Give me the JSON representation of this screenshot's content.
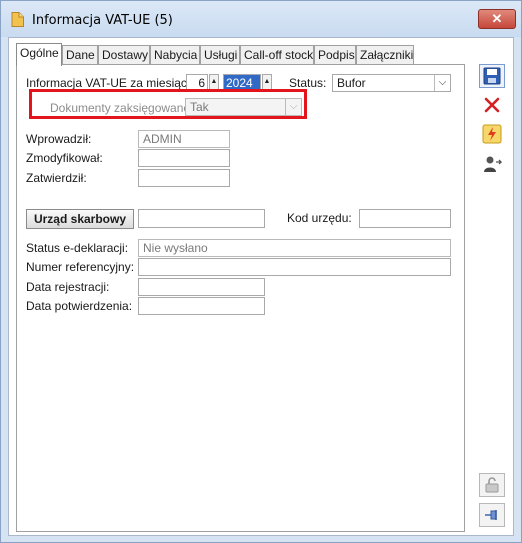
{
  "window": {
    "title": "Informacja VAT-UE (5)",
    "close_label": "✕"
  },
  "tabs": [
    {
      "label": "Ogólne",
      "active": true
    },
    {
      "label": "Dane"
    },
    {
      "label": "Dostawy"
    },
    {
      "label": "Nabycia"
    },
    {
      "label": "Usługi"
    },
    {
      "label": "Call-off stock"
    },
    {
      "label": "Podpis"
    },
    {
      "label": "Załączniki"
    }
  ],
  "form": {
    "period_label": "Informacja VAT-UE za miesiąc:",
    "month_value": "6",
    "year_value": "2024",
    "status_label": "Status:",
    "status_value": "Bufor",
    "posted_docs_label": "Dokumenty zaksięgowane:",
    "posted_docs_value": "Tak",
    "entered_by_label": "Wprowadził:",
    "entered_by_value": "ADMIN",
    "modified_by_label": "Zmodyfikował:",
    "modified_by_value": "",
    "approved_by_label": "Zatwierdził:",
    "approved_by_value": "",
    "tax_office_button": "Urząd skarbowy",
    "tax_office_value": "",
    "office_code_label": "Kod urzędu:",
    "office_code_value": "",
    "edecl_status_label": "Status e-deklaracji:",
    "edecl_status_value": "Nie wysłano",
    "ref_number_label": "Numer referencyjny:",
    "ref_number_value": "",
    "reg_date_label": "Data rejestracji:",
    "reg_date_value": "",
    "confirm_date_label": "Data potwierdzenia:",
    "confirm_date_value": ""
  },
  "toolbar": {
    "save_icon": "save-icon",
    "delete_icon": "delete-icon",
    "lightning_icon": "lightning-icon",
    "person_icon": "person-icon",
    "lock_icon": "lock-icon",
    "pin_icon": "pin-icon"
  },
  "colors": {
    "highlight_border": "#e3141c",
    "window_frame": "#d6e3f2",
    "selection": "#3169c6"
  }
}
